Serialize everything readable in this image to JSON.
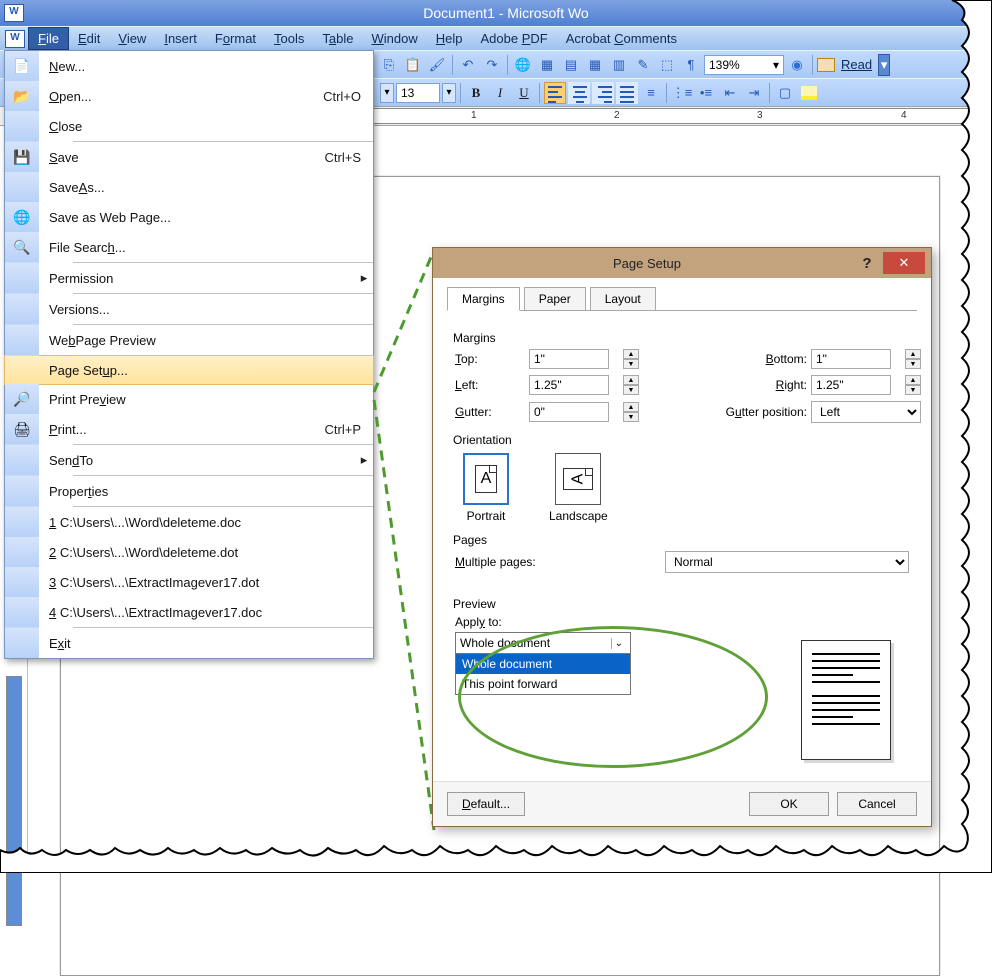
{
  "window": {
    "title": "Document1 - Microsoft Wo"
  },
  "menubar": [
    {
      "label": "File",
      "u": 0
    },
    {
      "label": "Edit",
      "u": 0
    },
    {
      "label": "View",
      "u": 0
    },
    {
      "label": "Insert",
      "u": 0
    },
    {
      "label": "Format",
      "u": 1
    },
    {
      "label": "Tools",
      "u": 0
    },
    {
      "label": "Table",
      "u": 1
    },
    {
      "label": "Window",
      "u": 0
    },
    {
      "label": "Help",
      "u": 0
    },
    {
      "label": "Adobe PDF",
      "u": 6
    },
    {
      "label": "Acrobat Comments",
      "u": 8
    }
  ],
  "toolbar": {
    "zoom": "139%",
    "read_label": "Read",
    "font_size": "13"
  },
  "ruler": {
    "marks": [
      "1",
      "2",
      "3",
      "4"
    ]
  },
  "filemenu": [
    {
      "icon": "📄",
      "label": "New...",
      "u": 0
    },
    {
      "icon": "📂",
      "label": "Open...",
      "u": 0,
      "shortcut": "Ctrl+O"
    },
    {
      "icon": "",
      "label": "Close",
      "u": 0
    },
    {
      "sep": true
    },
    {
      "icon": "💾",
      "label": "Save",
      "u": 0,
      "shortcut": "Ctrl+S"
    },
    {
      "icon": "",
      "label": "Save As...",
      "u": 5
    },
    {
      "icon": "🌐",
      "label": "Save as Web Page..."
    },
    {
      "icon": "🔍",
      "label": "File Search...",
      "u": 10
    },
    {
      "sep": true
    },
    {
      "icon": "",
      "label": "Permission",
      "arrow": true
    },
    {
      "sep": true
    },
    {
      "icon": "",
      "label": "Versions..."
    },
    {
      "sep": true
    },
    {
      "icon": "",
      "label": "Web Page Preview",
      "u": 3
    },
    {
      "sep": true
    },
    {
      "icon": "",
      "label": "Page Setup...",
      "u": 8,
      "hl": true
    },
    {
      "icon": "🔎",
      "label": "Print Preview",
      "u": 8
    },
    {
      "icon": "🖨",
      "label": "Print...",
      "u": 0,
      "shortcut": "Ctrl+P"
    },
    {
      "sep": true
    },
    {
      "icon": "",
      "label": "Send To",
      "u": 4,
      "arrow": true
    },
    {
      "sep": true
    },
    {
      "icon": "",
      "label": "Properties",
      "u": 6
    },
    {
      "sep": true
    },
    {
      "icon": "",
      "label": "1 C:\\Users\\...\\Word\\deleteme.doc",
      "u": 0
    },
    {
      "icon": "",
      "label": "2 C:\\Users\\...\\Word\\deleteme.dot",
      "u": 0
    },
    {
      "icon": "",
      "label": "3 C:\\Users\\...\\ExtractImagever17.dot",
      "u": 0
    },
    {
      "icon": "",
      "label": "4 C:\\Users\\...\\ExtractImagever17.doc",
      "u": 0
    },
    {
      "sep": true
    },
    {
      "icon": "",
      "label": "Exit",
      "u": 1
    }
  ],
  "dialog": {
    "title": "Page Setup",
    "tabs": [
      "Margins",
      "Paper",
      "Layout"
    ],
    "margins": {
      "section": "Margins",
      "top_label": "Top:",
      "top": "1\"",
      "bottom_label": "Bottom:",
      "bottom": "1\"",
      "left_label": "Left:",
      "left": "1.25\"",
      "right_label": "Right:",
      "right": "1.25\"",
      "gutter_label": "Gutter:",
      "gutter": "0\"",
      "gutterpos_label": "Gutter position:",
      "gutterpos": "Left"
    },
    "orientation": {
      "section": "Orientation",
      "portrait": "Portrait",
      "landscape": "Landscape"
    },
    "pages": {
      "section": "Pages",
      "label": "Multiple pages:",
      "value": "Normal"
    },
    "preview": {
      "section": "Preview",
      "applyto_label": "Apply to:",
      "applyto_value": "Whole document",
      "options": [
        "Whole document",
        "This point forward"
      ]
    },
    "buttons": {
      "default": "Default...",
      "ok": "OK",
      "cancel": "Cancel"
    }
  }
}
